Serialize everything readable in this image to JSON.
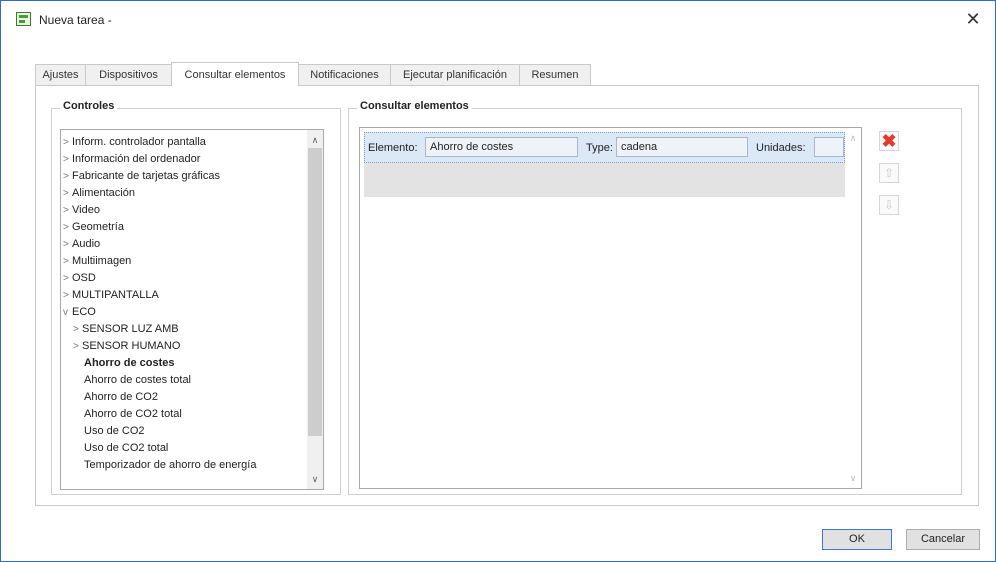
{
  "window": {
    "title": "Nueva tarea -",
    "close_glyph": "✕"
  },
  "tabs": [
    {
      "label": "Ajustes",
      "active": false
    },
    {
      "label": "Dispositivos",
      "active": false
    },
    {
      "label": "Consultar elementos",
      "active": true
    },
    {
      "label": "Notificaciones",
      "active": false
    },
    {
      "label": "Ejecutar planificación",
      "active": false
    },
    {
      "label": "Resumen",
      "active": false
    }
  ],
  "controls": {
    "title": "Controles",
    "items": [
      {
        "label": "Inform. controlador pantalla",
        "expander": ">"
      },
      {
        "label": "Información del ordenador",
        "expander": ">"
      },
      {
        "label": "Fabricante de tarjetas gráficas",
        "expander": ">"
      },
      {
        "label": "Alimentación",
        "expander": ">"
      },
      {
        "label": "Video",
        "expander": ">"
      },
      {
        "label": "Geometría",
        "expander": ">"
      },
      {
        "label": "Audio",
        "expander": ">"
      },
      {
        "label": "Multiimagen",
        "expander": ">"
      },
      {
        "label": "OSD",
        "expander": ">"
      },
      {
        "label": "MULTIPANTALLA",
        "expander": ">"
      },
      {
        "label": "ECO",
        "expander": "v"
      },
      {
        "label": "SENSOR LUZ AMB",
        "expander": ">"
      },
      {
        "label": "SENSOR HUMANO",
        "expander": ">"
      },
      {
        "label": "Ahorro de costes",
        "expander": "",
        "selected": true
      },
      {
        "label": "Ahorro de costes total",
        "expander": ""
      },
      {
        "label": "Ahorro de CO2",
        "expander": ""
      },
      {
        "label": "Ahorro de CO2 total",
        "expander": ""
      },
      {
        "label": "Uso de CO2",
        "expander": ""
      },
      {
        "label": "Uso de CO2 total",
        "expander": ""
      },
      {
        "label": "Temporizador de ahorro de energía",
        "expander": ""
      }
    ],
    "scroll_up": "∧",
    "scroll_down": "∨"
  },
  "query": {
    "title": "Consultar elementos",
    "row": {
      "element_label": "Elemento:",
      "element_value": "Ahorro de costes",
      "type_label": "Type:",
      "type_value": "cadena",
      "units_label": "Unidades:",
      "units_value": ""
    },
    "scroll_up": "∧",
    "scroll_down": "∨"
  },
  "side_buttons": {
    "delete_glyph": "✖",
    "up_glyph": "⇧",
    "down_glyph": "⇩"
  },
  "footer": {
    "ok_label": "OK",
    "cancel_label": "Cancelar"
  },
  "colors": {
    "accent": "#2b6cc4",
    "delete": "#e03b2c",
    "selection": "#dbe9f7"
  }
}
